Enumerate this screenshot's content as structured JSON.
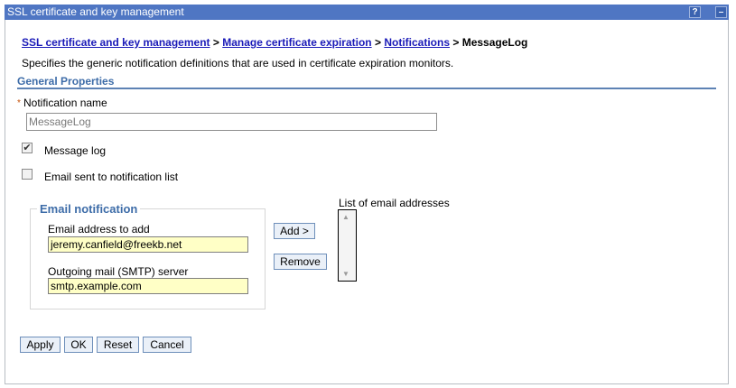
{
  "window": {
    "title": "SSL certificate and key management",
    "help_glyph": "?",
    "minimize_glyph": "–"
  },
  "breadcrumb": {
    "items": [
      "SSL certificate and key management",
      "Manage certificate expiration",
      "Notifications"
    ],
    "separator": ">",
    "current": "MessageLog"
  },
  "description": "Specifies the generic notification definitions that are used in certificate expiration monitors.",
  "general_properties": {
    "title": "General Properties",
    "required_marker": "*",
    "notification_name_label": "Notification name",
    "notification_name_value": "MessageLog",
    "message_log": {
      "label": "Message log",
      "checked": true
    },
    "email_list": {
      "label": "Email sent to notification list",
      "checked": false
    }
  },
  "email_notification": {
    "legend": "Email notification",
    "email_label": "Email address to add",
    "email_value": "jeremy.canfield@freekb.net",
    "smtp_label": "Outgoing mail (SMTP) server",
    "smtp_value": "smtp.example.com"
  },
  "list_buttons": {
    "add": "Add >",
    "remove": "Remove"
  },
  "email_list_label": "List of email addresses",
  "actions": {
    "apply": "Apply",
    "ok": "OK",
    "reset": "Reset",
    "cancel": "Cancel"
  },
  "colors": {
    "titlebar": "#4f76c3",
    "link": "#1a1ab8",
    "section": "#3d6ca8",
    "field_highlight": "#ffffc6"
  }
}
